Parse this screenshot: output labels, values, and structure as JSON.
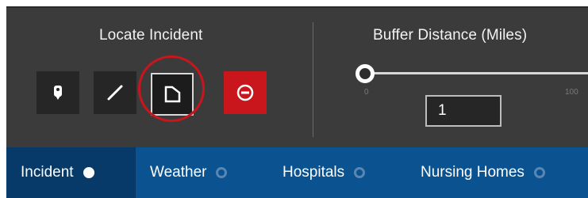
{
  "locate": {
    "title": "Locate Incident",
    "tools": [
      {
        "name": "point",
        "icon": "map-pin-icon"
      },
      {
        "name": "line",
        "icon": "line-draw-icon"
      },
      {
        "name": "polygon",
        "icon": "polygon-draw-icon",
        "selected": true
      },
      {
        "name": "clear",
        "icon": "clear-minus-circle-icon"
      }
    ]
  },
  "buffer": {
    "title": "Buffer Distance (Miles)",
    "slider_min": "0",
    "slider_max": "100",
    "value": "1"
  },
  "tabs": [
    {
      "label": "Incident",
      "active": true
    },
    {
      "label": "Weather",
      "active": false
    },
    {
      "label": "Hospitals",
      "active": false
    },
    {
      "label": "Nursing Homes",
      "active": false
    }
  ],
  "colors": {
    "panel_bg": "#3b3b3b",
    "tab_bar_bg": "#0a5290",
    "tab_active_bg": "#073a69",
    "clear_button": "#c9161d",
    "highlight_circle": "#c9161d"
  }
}
